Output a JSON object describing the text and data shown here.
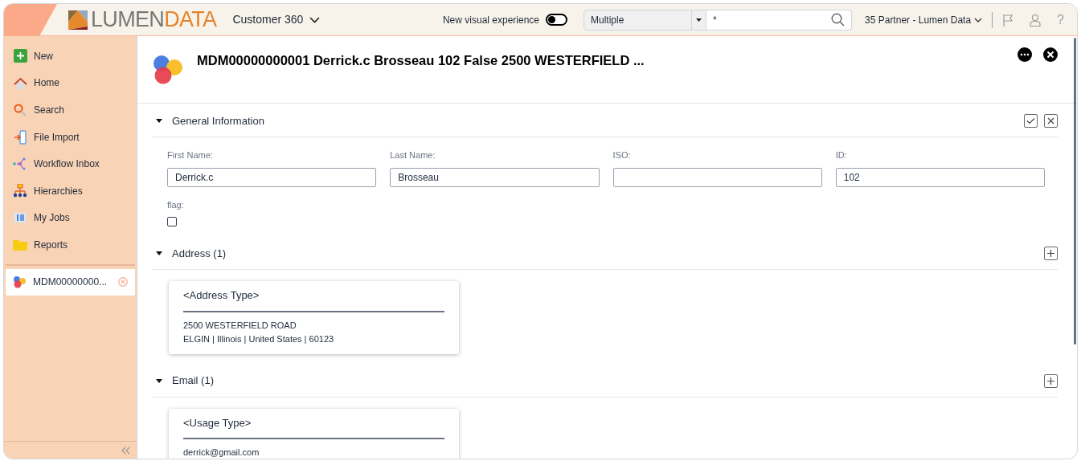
{
  "header": {
    "brand_light": "LUMEN",
    "brand_bold": "DATA",
    "app_menu": "Customer 360",
    "visual_toggle": {
      "label": "New visual experience",
      "on": false
    },
    "search_scope": "Multiple",
    "search_value": "*",
    "account": "35 Partner - Lumen Data",
    "help": "?"
  },
  "sidebar": {
    "items": [
      {
        "label": "New"
      },
      {
        "label": "Home"
      },
      {
        "label": "Search"
      },
      {
        "label": "File Import"
      },
      {
        "label": "Workflow Inbox"
      },
      {
        "label": "Hierarchies"
      },
      {
        "label": "My Jobs"
      },
      {
        "label": "Reports"
      }
    ],
    "open_records": [
      {
        "label": "MDM00000000...",
        "selected": true
      }
    ]
  },
  "record": {
    "title": "MDM00000000001 Derrick.c Brosseau 102 False 2500 WESTERFIELD ...",
    "sections": [
      {
        "kind": "fields",
        "title": "General Information",
        "expanded": true,
        "fields": [
          {
            "label": "First Name:",
            "value": "Derrick.c"
          },
          {
            "label": "Last Name:",
            "value": "Brosseau"
          },
          {
            "label": "ISO:"
          },
          {
            "label": "ID:",
            "value": "102"
          }
        ],
        "checkboxes": [
          {
            "label": "flag:",
            "checked": false
          }
        ]
      },
      {
        "kind": "cards",
        "title": "Address (1)",
        "expanded": true,
        "cards": [
          {
            "heading": "<Address Type>",
            "lines": [
              "2500 WESTERFIELD ROAD",
              "ELGIN | Illinois | United States | 60123"
            ]
          }
        ]
      },
      {
        "kind": "cards",
        "title": "Email (1)",
        "expanded": true,
        "cards": [
          {
            "heading": "<Usage Type>",
            "lines": [
              "derrick@gmail.com"
            ]
          }
        ]
      }
    ]
  }
}
